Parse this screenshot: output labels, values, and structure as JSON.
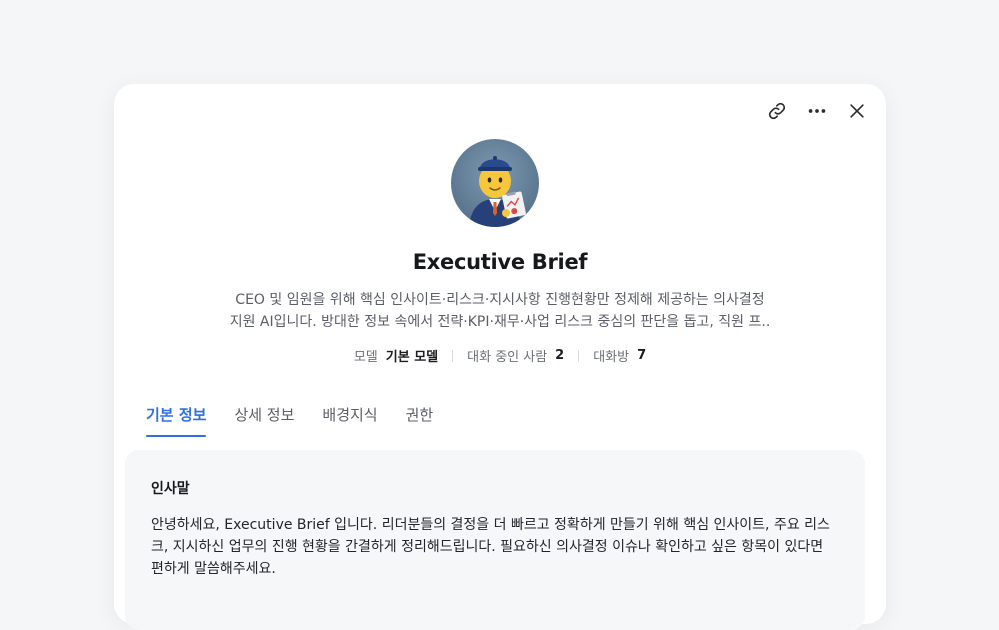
{
  "profile": {
    "name": "Executive Brief",
    "description_line1": "CEO 및 임원을 위해 핵심 인사이트·리스크·지시사항 진행현황만 정제해 제공하는 의사결정",
    "description_line2": "지원 AI입니다. 방대한 정보 속에서 전략·KPI·재무·사업 리스크 중심의 판단을 돕고, 직원 프.."
  },
  "meta": {
    "model_label": "모델",
    "model_value": "기본 모델",
    "chatting_label": "대화 중인 사람",
    "chatting_value": "2",
    "rooms_label": "대화방",
    "rooms_value": "7"
  },
  "tabs": [
    {
      "label": "기본 정보",
      "active": true
    },
    {
      "label": "상세 정보",
      "active": false
    },
    {
      "label": "배경지식",
      "active": false
    },
    {
      "label": "권한",
      "active": false
    }
  ],
  "greeting": {
    "title": "인사말",
    "line1": "안녕하세요, Executive Brief 입니다. 리더분들의 결정을 더 빠르고 정확하게 만들기 위해 핵심 인사이트, 주요 리스",
    "line2": "크, 지시하신 업무의 진행 현황을 간결하게 정리해드립니다. 필요하신 의사결정 이슈나 확인하고 싶은 항목이 있다면",
    "line3": "편하게 말씀해주세요."
  },
  "icons": {
    "link": "link-icon",
    "more": "more-horizontal-icon",
    "close": "close-icon"
  },
  "colors": {
    "accent": "#2f6fe0",
    "background": "#f5f6f8",
    "card": "#ffffff",
    "section": "#f6f7f9"
  }
}
